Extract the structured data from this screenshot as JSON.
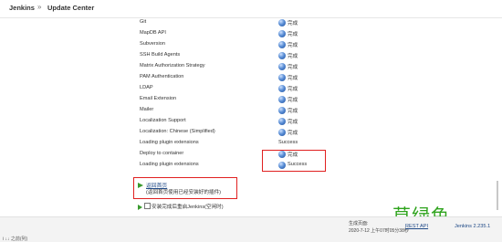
{
  "breadcrumb": {
    "home": "Jenkins",
    "separator": "»",
    "current": "Update Center"
  },
  "plugins": [
    {
      "name": "Git",
      "status": "完成",
      "icon": "blue-ball-icon"
    },
    {
      "name": "MapDB API",
      "status": "完成",
      "icon": "blue-ball-icon"
    },
    {
      "name": "Subversion",
      "status": "完成",
      "icon": "blue-ball-icon"
    },
    {
      "name": "SSH Build Agents",
      "status": "完成",
      "icon": "blue-ball-icon"
    },
    {
      "name": "Matrix Authorization Strategy",
      "status": "完成",
      "icon": "blue-ball-icon"
    },
    {
      "name": "PAM Authentication",
      "status": "完成",
      "icon": "blue-ball-icon"
    },
    {
      "name": "LDAP",
      "status": "完成",
      "icon": "blue-ball-icon"
    },
    {
      "name": "Email Extension",
      "status": "完成",
      "icon": "blue-ball-icon"
    },
    {
      "name": "Mailer",
      "status": "完成",
      "icon": "blue-ball-icon"
    },
    {
      "name": "Localization Support",
      "status": "完成",
      "icon": "blue-ball-icon"
    },
    {
      "name": "Localization: Chinese (Simplified)",
      "status": "完成",
      "icon": "blue-ball-icon"
    },
    {
      "name": "Loading plugin extensions",
      "status": "Success",
      "icon": ""
    },
    {
      "name": "Deploy to container",
      "status": "完成",
      "icon": "blue-ball-icon"
    },
    {
      "name": "Loading plugin extensions",
      "status": "Success",
      "icon": "blue-ball-icon"
    }
  ],
  "back": {
    "link": "返回首页",
    "desc": "(返回首页使用已经安装好的插件)"
  },
  "restart": {
    "label": "安装完成后重启Jenkins(空闲时)"
  },
  "watermark": "草绿色",
  "footer": {
    "generated_label": "生成页面:",
    "generated_time": "2020-7-12 上午07时05分38秒",
    "rest": "REST API",
    "version": "Jenkins 2.235.1"
  },
  "corner": "i ↓↓ 之前(列)",
  "colors": {
    "highlight": "#e02020",
    "accent_green": "#2ea31c",
    "link": "#204a87"
  }
}
